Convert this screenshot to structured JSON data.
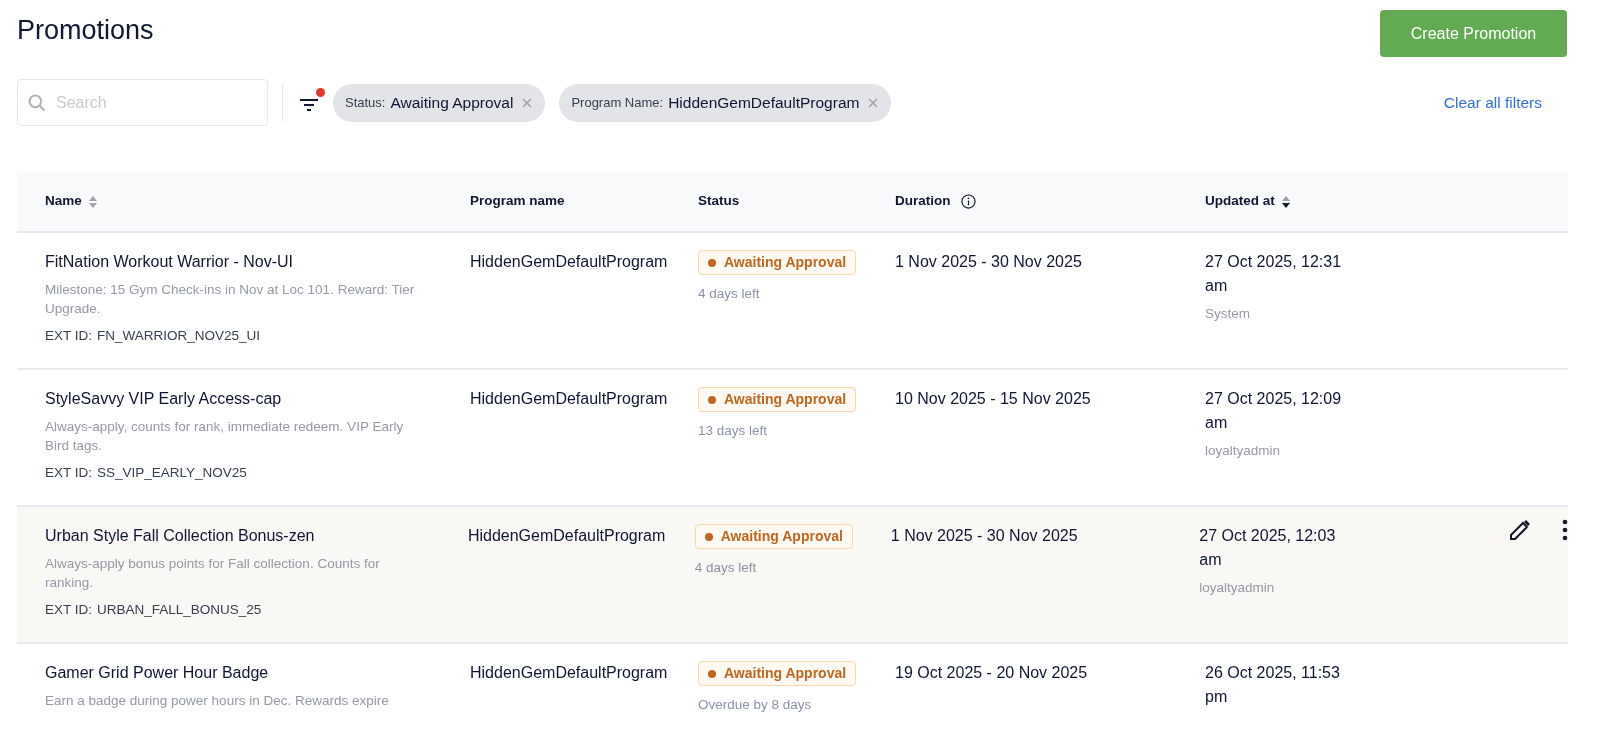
{
  "title": "Promotions",
  "create_button": "Create Promotion",
  "search": {
    "placeholder": "Search"
  },
  "filter_indicator": true,
  "filters": [
    {
      "label": "Status:",
      "value": "Awaiting Approval"
    },
    {
      "label": "Program Name:",
      "value": "HiddenGemDefaultProgram"
    }
  ],
  "clear_filters": "Clear all filters",
  "columns": [
    {
      "label": "Name",
      "sortable": true,
      "sorted": false
    },
    {
      "label": "Program name"
    },
    {
      "label": "Status"
    },
    {
      "label": "Duration",
      "info": true
    },
    {
      "label": "Updated at",
      "sortable": true,
      "sorted": true
    }
  ],
  "rows": [
    {
      "name": "FitNation Workout Warrior - Nov-UI",
      "description": "Milestone: 15 Gym Check-ins in Nov at Loc 101. Reward: Tier Upgrade.",
      "ext_id_label": "EXT ID:",
      "ext_id": "FN_WARRIOR_NOV25_UI",
      "program": "HiddenGemDefaultProgram",
      "status": "Awaiting Approval",
      "due": "4 days left",
      "duration": "1 Nov 2025 - 30 Nov 2025",
      "updated": "27 Oct 2025, 12:31 am",
      "updated_by": "System",
      "hovered": false
    },
    {
      "name": "StyleSavvy VIP Early Access-cap",
      "description": "Always-apply, counts for rank, immediate redeem. VIP Early Bird tags.",
      "ext_id_label": "EXT ID:",
      "ext_id": "SS_VIP_EARLY_NOV25",
      "program": "HiddenGemDefaultProgram",
      "status": "Awaiting Approval",
      "due": "13 days left",
      "duration": "10 Nov 2025 - 15 Nov 2025",
      "updated": "27 Oct 2025, 12:09 am",
      "updated_by": "loyaltyadmin",
      "hovered": false
    },
    {
      "name": "Urban Style Fall Collection Bonus-zen",
      "description": "Always-apply bonus points for Fall collection. Counts for ranking.",
      "ext_id_label": "EXT ID:",
      "ext_id": "URBAN_FALL_BONUS_25",
      "program": "HiddenGemDefaultProgram",
      "status": "Awaiting Approval",
      "due": "4 days left",
      "duration": "1 Nov 2025 - 30 Nov 2025",
      "updated": "27 Oct 2025, 12:03 am",
      "updated_by": "loyaltyadmin",
      "hovered": true
    },
    {
      "name": "Gamer Grid Power Hour Badge",
      "description": "Earn a badge during power hours in Dec. Rewards expire",
      "program": "HiddenGemDefaultProgram",
      "status": "Awaiting Approval",
      "due": "Overdue by 8 days",
      "duration": "19 Oct 2025 - 20 Nov 2025",
      "updated": "26 Oct 2025, 11:53 pm",
      "hovered": false
    }
  ]
}
